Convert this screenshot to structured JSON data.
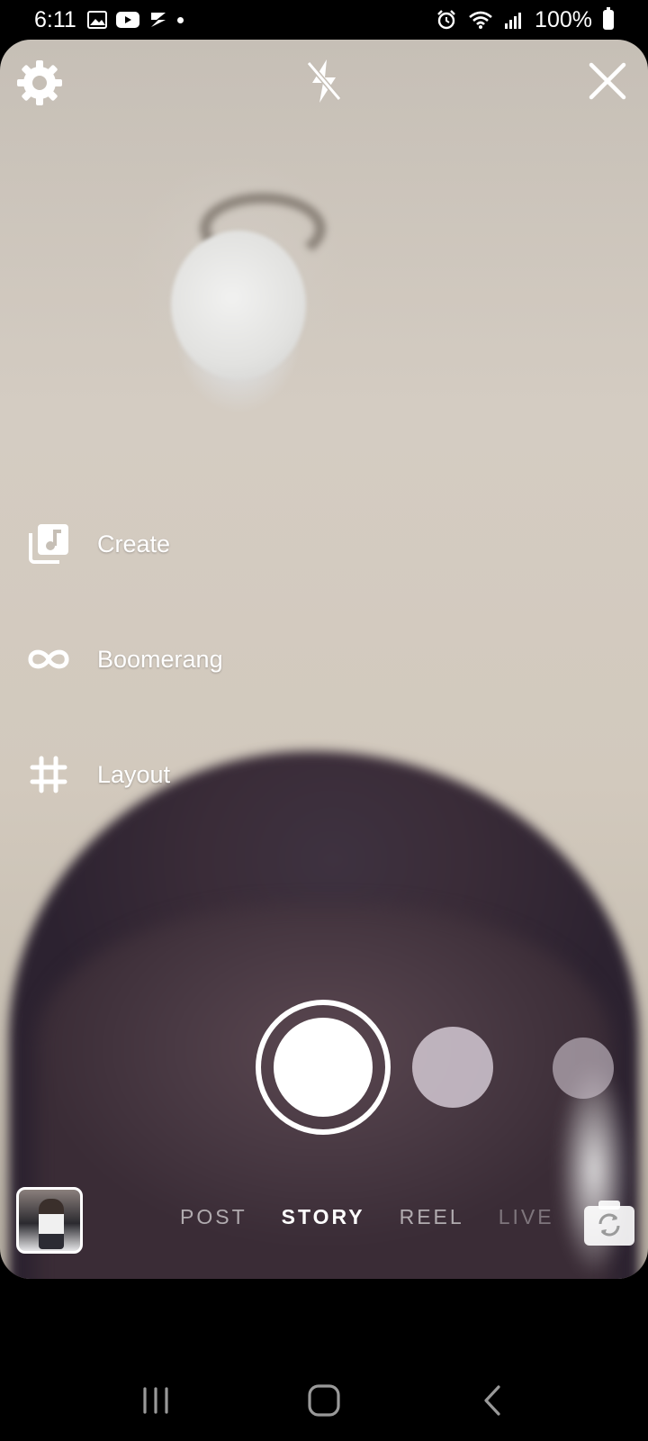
{
  "status_bar": {
    "time": "6:11",
    "battery": "100%",
    "icons": [
      "image-icon",
      "youtube-icon",
      "app-icon",
      "dot-icon",
      "alarm-icon",
      "wifi-icon",
      "signal-icon",
      "battery-icon"
    ]
  },
  "top_controls": {
    "settings": "gear-icon",
    "flash": "flash-off-icon",
    "close": "close-icon"
  },
  "side_menu": {
    "items": [
      {
        "label": "Create",
        "icon": "music-square-icon"
      },
      {
        "label": "Boomerang",
        "icon": "infinity-icon"
      },
      {
        "label": "Layout",
        "icon": "hashtag-icon"
      }
    ]
  },
  "modes": {
    "tabs": [
      "POST",
      "STORY",
      "REEL",
      "LIVE"
    ],
    "active": "STORY"
  },
  "colors": {
    "accent": "#ffffff",
    "background": "#000000"
  },
  "navbar": {
    "items": [
      "recent-apps-icon",
      "home-icon",
      "back-icon"
    ]
  }
}
